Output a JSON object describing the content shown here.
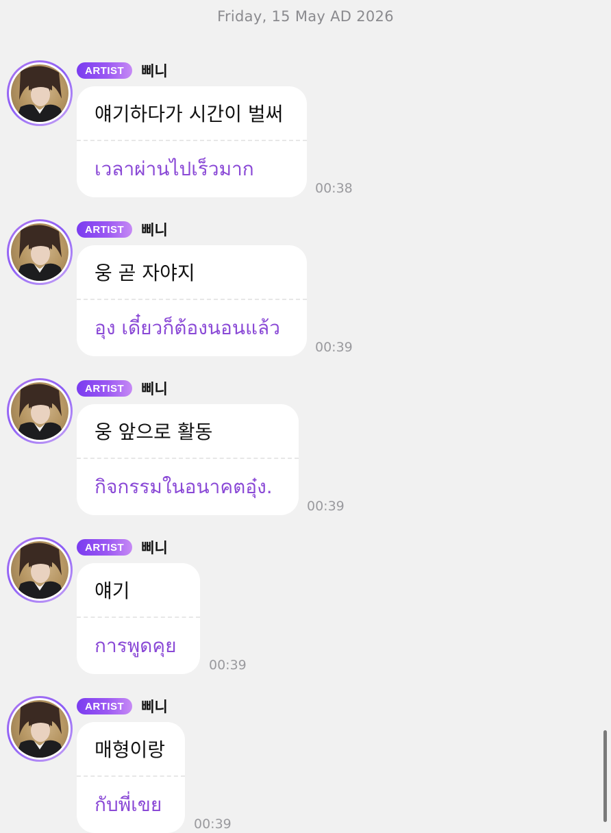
{
  "date_header": "Friday, 15 May AD 2026",
  "badge_label": "ARTIST",
  "sender_name": "삐니",
  "messages": [
    {
      "original": "얘기하다가 시간이 벌써",
      "translation": "เวลาผ่านไปเร็วมาก",
      "time": "00:38"
    },
    {
      "original": "웅 곧 자야지",
      "translation": "อุง เดี๋ยวก็ต้องนอนแล้ว",
      "time": "00:39"
    },
    {
      "original": "웅 앞으로 활동",
      "translation": "กิจกรรมในอนาคตอุ๋ง.",
      "time": "00:39"
    },
    {
      "original": "얘기",
      "translation": "การพูดคุย",
      "time": "00:39"
    },
    {
      "original": "매형이랑",
      "translation": "กับพี่เขย",
      "time": "00:39"
    }
  ],
  "colors": {
    "background": "#f1f1f1",
    "bubble": "#ffffff",
    "translation_text": "#8a49d6",
    "badge_gradient_start": "#7a3cf0",
    "badge_gradient_end": "#c68af5",
    "timestamp": "#9a9a9e"
  },
  "icons": {
    "avatar": "artist-avatar-photo"
  }
}
